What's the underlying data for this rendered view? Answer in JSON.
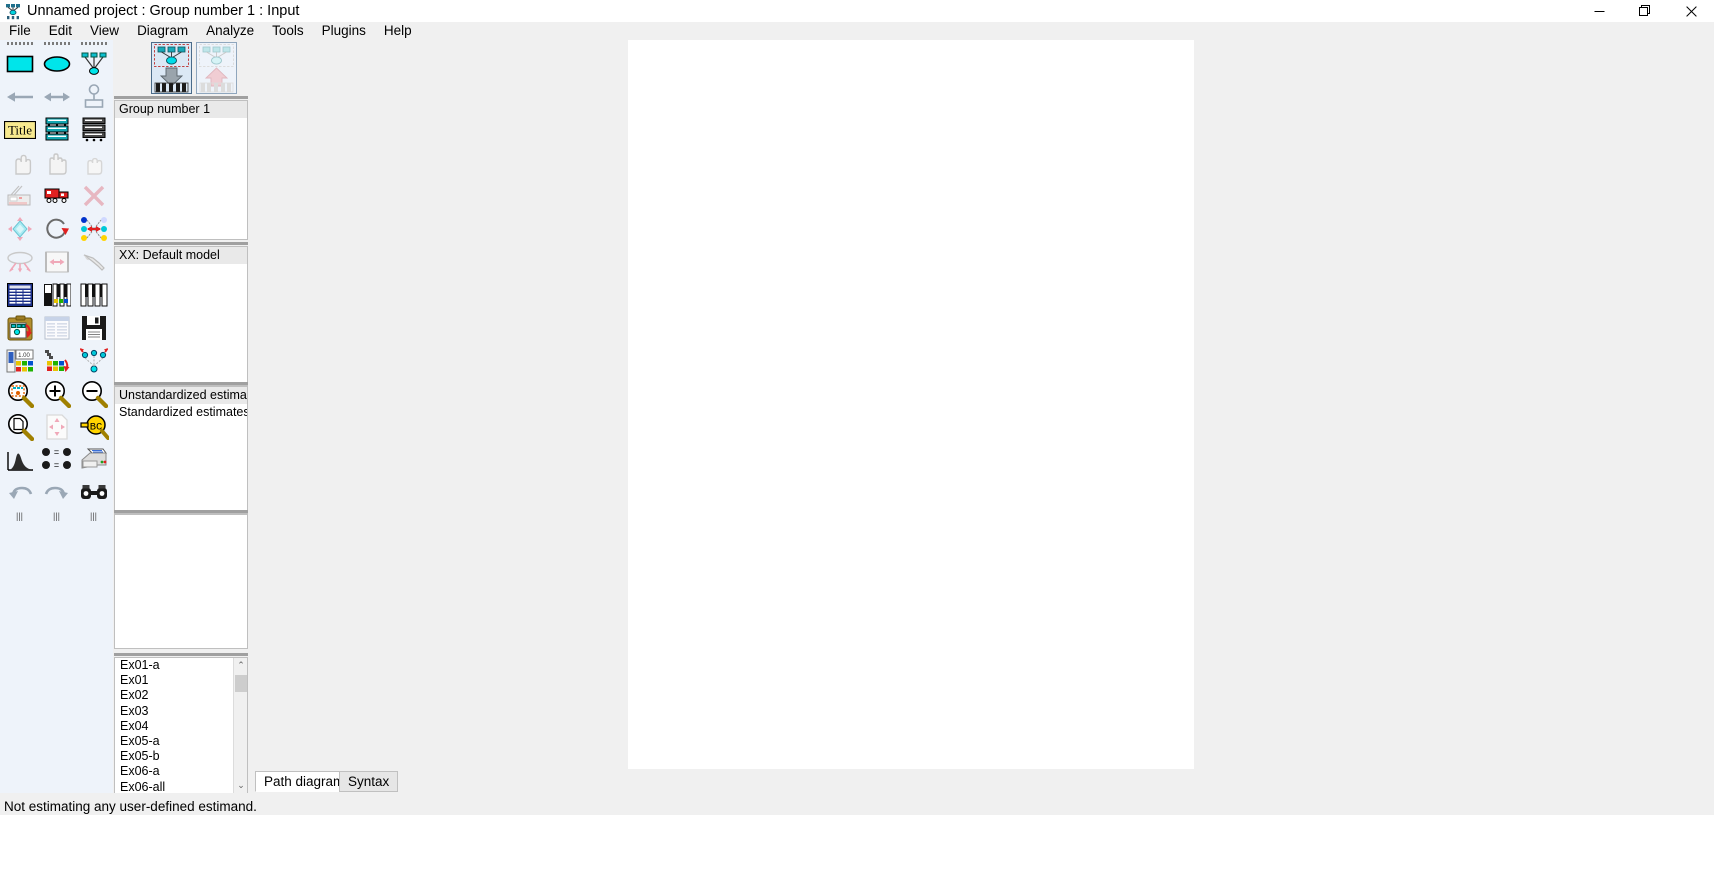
{
  "window": {
    "title": "Unnamed project : Group number 1 : Input",
    "app_icon": "amos-icon",
    "controls": {
      "minimize": "—",
      "restore": "❐",
      "close": "✕"
    }
  },
  "menubar": {
    "items": [
      {
        "label": "File",
        "name": "menu-file"
      },
      {
        "label": "Edit",
        "name": "menu-edit"
      },
      {
        "label": "View",
        "name": "menu-view"
      },
      {
        "label": "Diagram",
        "name": "menu-diagram"
      },
      {
        "label": "Analyze",
        "name": "menu-analyze"
      },
      {
        "label": "Tools",
        "name": "menu-tools"
      },
      {
        "label": "Plugins",
        "name": "menu-plugins"
      },
      {
        "label": "Help",
        "name": "menu-help"
      }
    ]
  },
  "toolpalette": {
    "rows": [
      [
        "draw-observed-variable-icon",
        "draw-unobserved-variable-icon",
        "draw-path-latent-icon"
      ],
      [
        "draw-path-icon",
        "draw-covariance-icon",
        "add-unique-variable-icon"
      ],
      [
        "figure-caption-icon",
        "list-variables-in-dataset-icon",
        "list-variables-in-model-icon"
      ],
      [
        "select-one-object-icon",
        "select-all-objects-icon",
        "deselect-all-objects-icon"
      ],
      [
        "duplicate-objects-icon",
        "move-objects-icon",
        "erase-objects-icon"
      ],
      [
        "change-shape-icon",
        "rotate-indicators-icon",
        "reflect-indicators-icon"
      ],
      [
        "move-parameter-icon",
        "scroll-diagram-icon",
        "touch-up-variable-icon"
      ],
      [
        "select-data-file-icon",
        "analysis-properties-icon",
        "object-properties-icon"
      ],
      [
        "copy-to-clipboard-icon",
        "view-text-output-icon",
        "save-diagram-icon"
      ],
      [
        "object-properties-panel-icon",
        "drag-properties-icon",
        "preserve-symmetries-icon"
      ],
      [
        "zoom-select-icon",
        "zoom-in-icon",
        "zoom-out-icon"
      ],
      [
        "zoom-page-icon",
        "resize-diagram-to-page-icon",
        "loupe-icon"
      ],
      [
        "bayesian-estimation-icon",
        "multiple-group-analysis-icon",
        "print-icon"
      ],
      [
        "undo-icon",
        "redo-icon",
        "search-icon"
      ]
    ]
  },
  "midpanel": {
    "icon_strip": {
      "input_view_label": "view-input-path-diagram-icon",
      "output_view_label": "view-output-path-diagram-icon",
      "active": "input"
    },
    "groups_panel": {
      "name": "groups-list",
      "items": [
        {
          "label": "Group number 1",
          "selected": true
        }
      ]
    },
    "models_panel": {
      "name": "models-list",
      "items": [
        {
          "label": "XX: Default model",
          "selected": true
        }
      ]
    },
    "estimates_panel": {
      "name": "estimates-list",
      "items": [
        {
          "label": "Unstandardized estimates",
          "selected": true
        },
        {
          "label": "Standardized estimates",
          "selected": false
        }
      ]
    },
    "empty_panel": {
      "name": "parameter-format-list",
      "items": []
    },
    "files_panel": {
      "name": "files-list",
      "items": [
        {
          "label": "Ex01-a"
        },
        {
          "label": "Ex01"
        },
        {
          "label": "Ex02"
        },
        {
          "label": "Ex03"
        },
        {
          "label": "Ex04"
        },
        {
          "label": "Ex05-a"
        },
        {
          "label": "Ex05-b"
        },
        {
          "label": "Ex06-a"
        },
        {
          "label": "Ex06-all"
        }
      ],
      "scroll_up": "⌃",
      "scroll_down": "⌄"
    }
  },
  "tabs": [
    {
      "label": "Path diagram",
      "active": true,
      "name": "tab-path-diagram"
    },
    {
      "label": "Syntax",
      "active": false,
      "name": "tab-syntax"
    }
  ],
  "statusbar": {
    "message": "Not estimating any user-defined estimand."
  },
  "colors": {
    "chrome": "#f0f0f0",
    "palette_bg": "#eef3fa",
    "page": "#ffffff",
    "accent_cyan": "#00e5e5",
    "selection": "#e9e9e9",
    "border": "#bfbfbf"
  }
}
